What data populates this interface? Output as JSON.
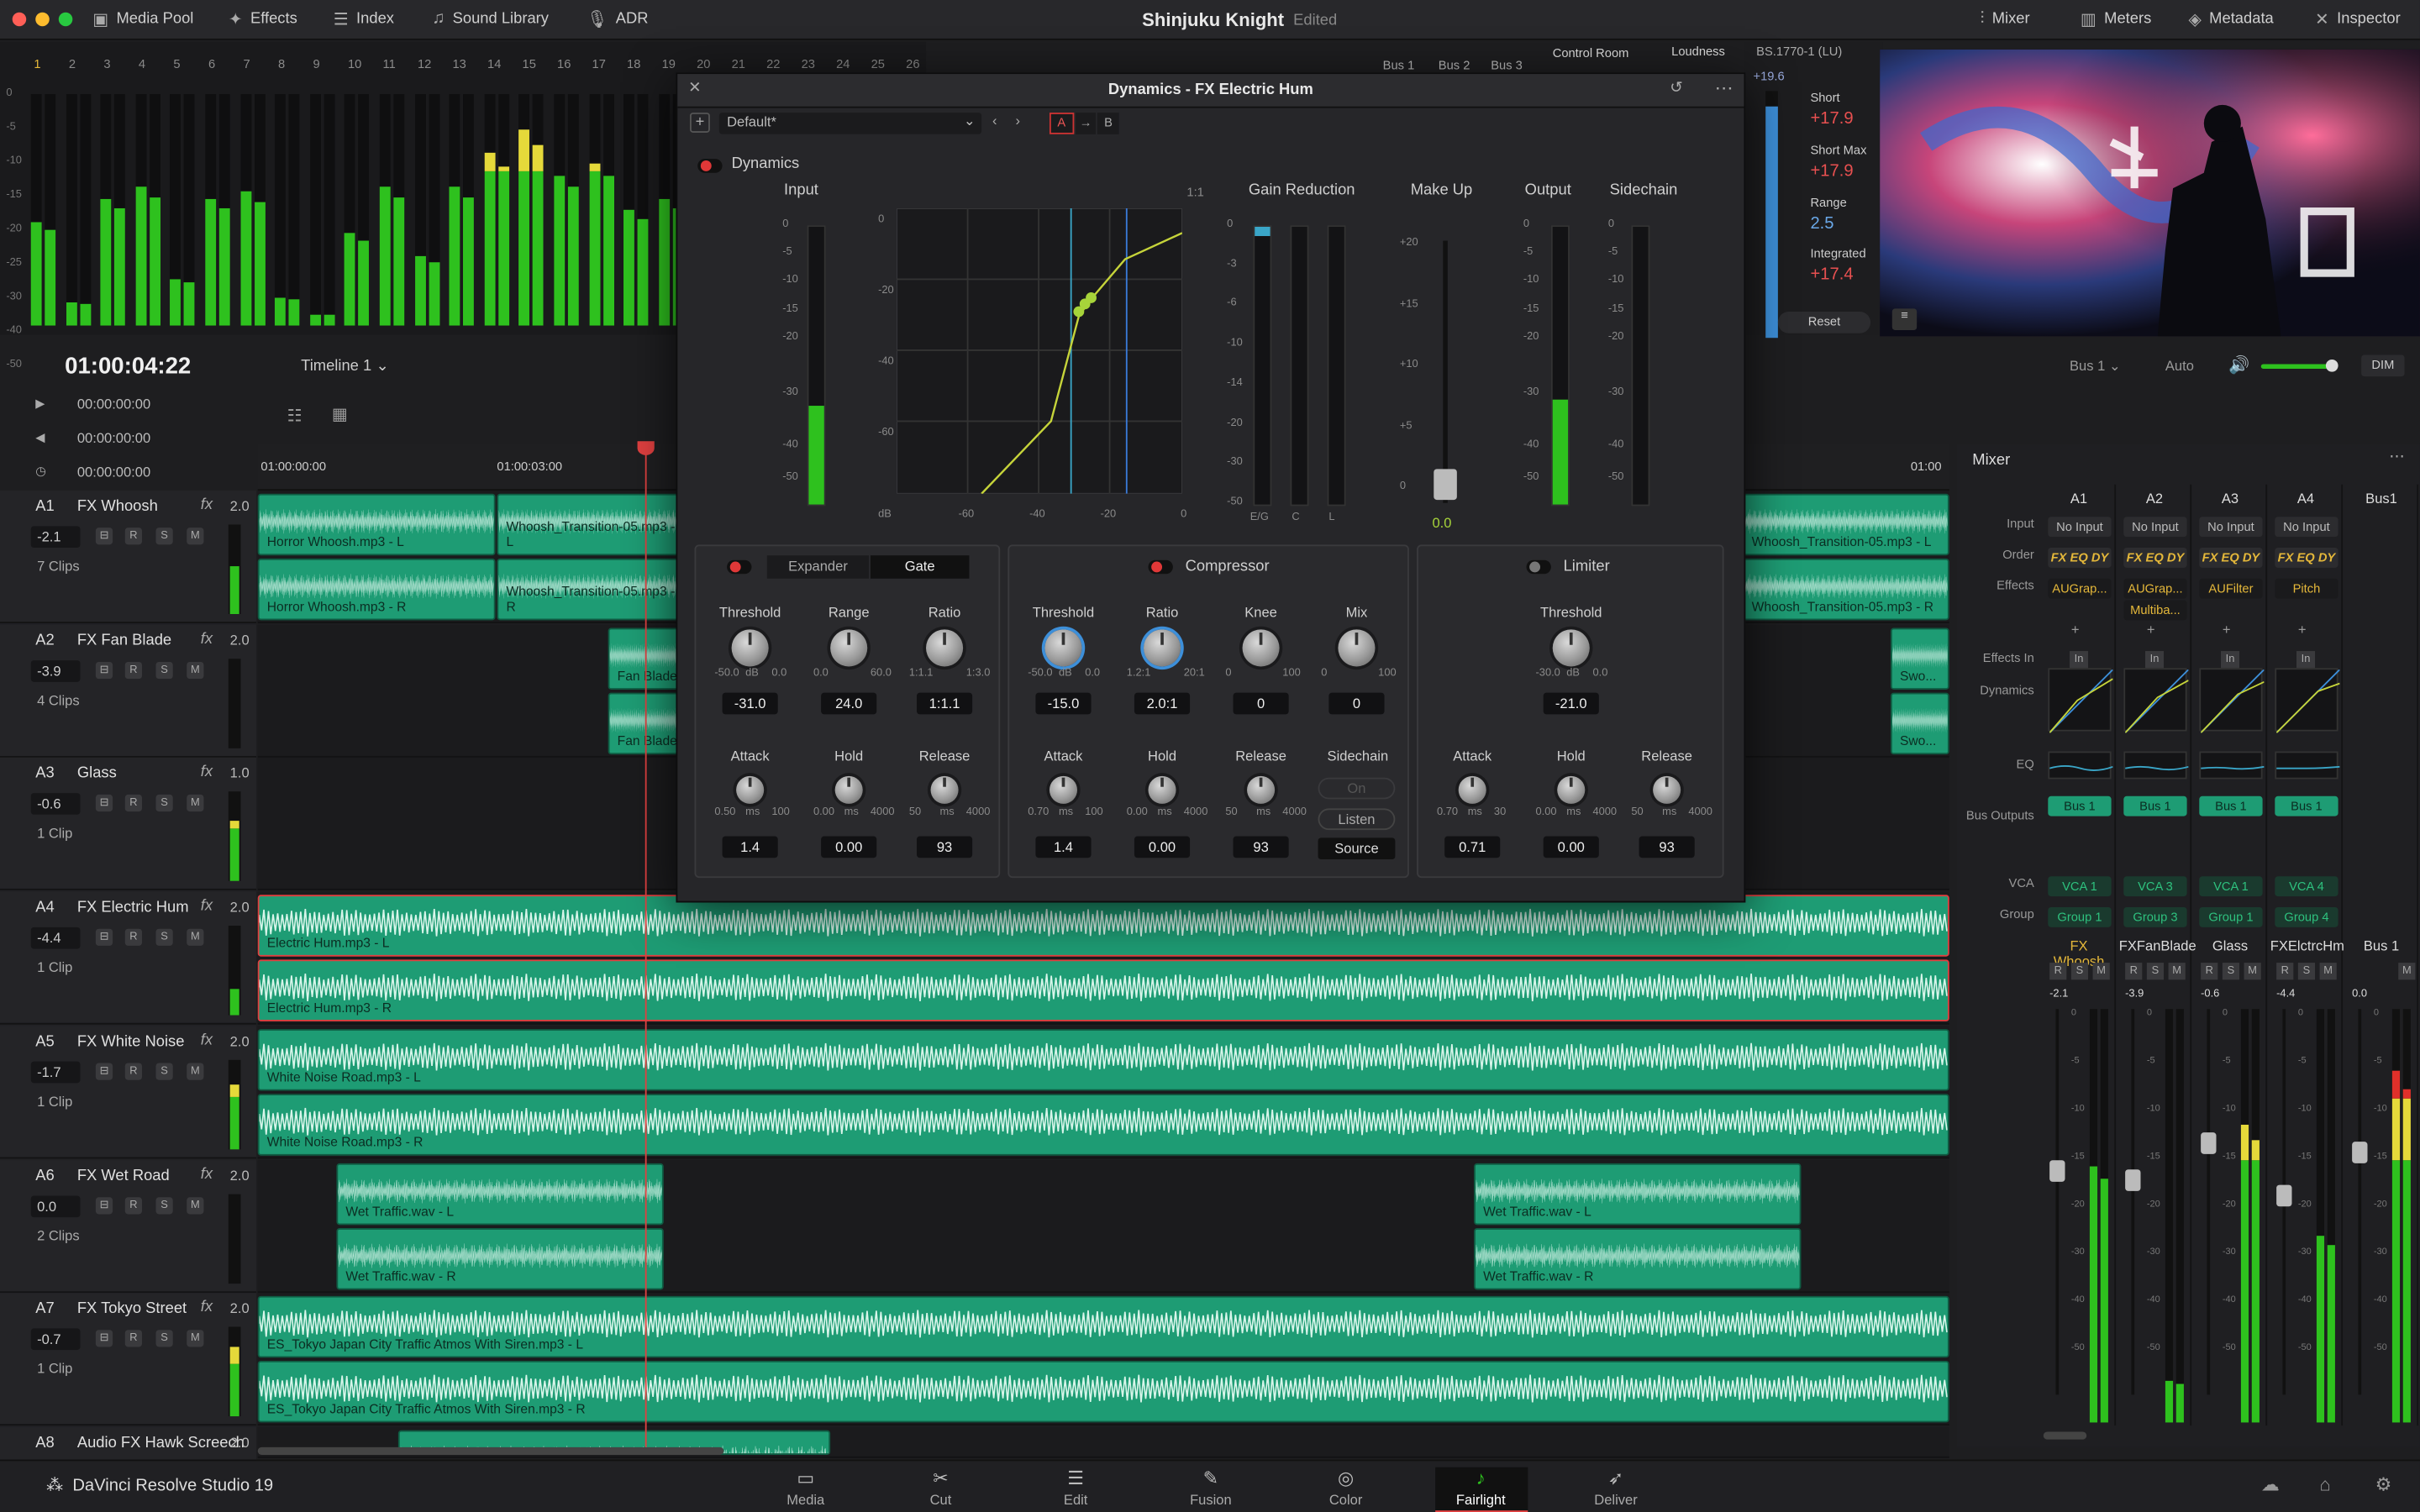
{
  "app": {
    "title": "Shinjuku Knight",
    "status": "Edited",
    "product": "DaVinci Resolve Studio 19"
  },
  "topbar": {
    "left": [
      {
        "icon": "media-pool-icon",
        "label": "Media Pool"
      },
      {
        "icon": "effects-icon",
        "label": "Effects"
      },
      {
        "icon": "index-icon",
        "label": "Index"
      },
      {
        "icon": "sound-library-icon",
        "label": "Sound Library"
      },
      {
        "icon": "adr-icon",
        "label": "ADR"
      }
    ],
    "right": [
      {
        "icon": "mixer-icon",
        "label": "Mixer"
      },
      {
        "icon": "meters-icon",
        "label": "Meters"
      },
      {
        "icon": "metadata-icon",
        "label": "Metadata"
      },
      {
        "icon": "inspector-icon",
        "label": "Inspector"
      }
    ]
  },
  "meters": {
    "channels": [
      "1",
      "2",
      "3",
      "4",
      "5",
      "6",
      "7",
      "8",
      "9",
      "10",
      "11",
      "12",
      "13",
      "14",
      "15",
      "16",
      "17",
      "18",
      "19",
      "20",
      "21",
      "22",
      "23",
      "24",
      "25",
      "26"
    ],
    "db_labels": [
      "0",
      "-5",
      "-10",
      "-15",
      "-20",
      "-25",
      "-30",
      "-40",
      "-50"
    ],
    "levels": [
      0.45,
      0.1,
      0.55,
      0.6,
      0.2,
      0.55,
      0.58,
      0.12,
      0.05,
      0.4,
      0.6,
      0.3,
      0.6,
      0.75,
      0.85,
      0.65,
      0.7,
      0.5,
      0.55,
      0.45,
      0.3,
      0.4,
      0.5,
      0.3,
      0.2,
      0.1
    ]
  },
  "monitor": {
    "tabs": [
      "Bus 1",
      "Bus 2",
      "Bus 3"
    ],
    "control_room": "Control Room",
    "loudness": "Loudness",
    "standard": "BS.1770-1 (LU)",
    "scale_top": "+19.6",
    "short_label": "Short",
    "short_value": "+17.9",
    "shortmax_label": "Short Max",
    "shortmax_value": "+17.9",
    "range_label": "Range",
    "range_value": "2.5",
    "integrated_label": "Integrated",
    "integrated_value": "+17.4",
    "reset": "Reset"
  },
  "timeline": {
    "timecode": "01:00:04:22",
    "name": "Timeline 1",
    "tc_rows": [
      "00:00:00:00",
      "00:00:00:00",
      "00:00:00:00"
    ],
    "ruler": [
      "01:00:00:00",
      "01:00:03:00",
      "01:00"
    ],
    "bus_select": "Bus 1",
    "auto": "Auto",
    "dim": "DIM",
    "tracks": [
      {
        "id": "A1",
        "name": "FX Whoosh",
        "ch": "2.0",
        "vol": "-2.1",
        "clips": "7 Clips",
        "level": 0.55
      },
      {
        "id": "A2",
        "name": "FX Fan Blade",
        "ch": "2.0",
        "vol": "-3.9",
        "clips": "4 Clips",
        "level": 0.0
      },
      {
        "id": "A3",
        "name": "Glass",
        "ch": "1.0",
        "vol": "-0.6",
        "clips": "1 Clip",
        "level": 0.7
      },
      {
        "id": "A4",
        "name": "FX Electric Hum",
        "ch": "2.0",
        "vol": "-4.4",
        "clips": "1 Clip",
        "level": 0.3
      },
      {
        "id": "A5",
        "name": "FX White Noise",
        "ch": "2.0",
        "vol": "-1.7",
        "clips": "1 Clip",
        "level": 0.75
      },
      {
        "id": "A6",
        "name": "FX Wet Road",
        "ch": "2.0",
        "vol": "0.0",
        "clips": "2 Clips",
        "level": 0.0
      },
      {
        "id": "A7",
        "name": "FX Tokyo Street",
        "ch": "2.0",
        "vol": "-0.7",
        "clips": "1 Clip",
        "level": 0.8
      },
      {
        "id": "A8",
        "name": "Audio FX Hawk Screech",
        "ch": "2.0",
        "vol": "",
        "clips": "",
        "level": 0.0
      }
    ],
    "clip_labels": {
      "horror_l": "Horror Whoosh.mp3 - L",
      "horror_r": "Horror Whoosh.mp3 - R",
      "whoosh_l": "Whoosh_Transition-05.mp3 - L",
      "whoosh_r": "Whoosh_Transition-05.mp3 - R",
      "whoosh2_l": "Whoosh_Transition-05.mp3 - L",
      "whoosh2_r": "Whoosh_Transition-05.mp3 - R",
      "fan_l": "Fan Blade",
      "fan_r": "Fan Blade",
      "swo_l": "Swo...",
      "swo_r": "Swo...",
      "hum_l": "Electric Hum.mp3 - L",
      "hum_r": "Electric Hum.mp3 - R",
      "wn_l": "White Noise Road.mp3 - L",
      "wn_r": "White Noise Road.mp3 - R",
      "wet_l": "Wet Traffic.wav - L",
      "wet_r": "Wet Traffic.wav - R",
      "wet2_l": "Wet Traffic.wav - L",
      "wet2_r": "Wet Traffic.wav - R",
      "es_l": "ES_Tokyo Japan City Traffic Atmos With Siren.mp3 - L",
      "es_r": "ES_Tokyo Japan City Traffic Atmos With Siren.mp3 - R"
    }
  },
  "dynamics": {
    "title": "Dynamics - FX Electric Hum",
    "preset": "Default*",
    "ab": [
      "A",
      "→",
      "B"
    ],
    "section_label": "Dynamics",
    "input": "Input",
    "ratio_tag": "1:1",
    "gain_reduction": "Gain Reduction",
    "make_up": "Make Up",
    "output": "Output",
    "sidechain": "Sidechain",
    "makeup_value": "0.0",
    "graph_y": [
      "0",
      "-20",
      "-40",
      "-60"
    ],
    "graph_x": [
      "dB",
      "-60",
      "-40",
      "-20",
      "0"
    ],
    "input_scale": [
      "0",
      "-5",
      "-10",
      "-15",
      "-20",
      "-30",
      "-40",
      "-50"
    ],
    "gr_scale": [
      "0",
      "-3",
      "-6",
      "-10",
      "-14",
      "-20",
      "-30",
      "-50"
    ],
    "gr_foot": [
      "E/G",
      "C",
      "L"
    ],
    "makeup_scale": [
      "+20",
      "+15",
      "+10",
      "+5",
      "0"
    ],
    "expander": {
      "tab_expander": "Expander",
      "tab_gate": "Gate",
      "threshold": {
        "label": "Threshold",
        "min": "-50.0",
        "unit": "dB",
        "max": "0.0",
        "value": "-31.0"
      },
      "range": {
        "label": "Range",
        "min": "0.0",
        "max": "60.0",
        "value": "24.0"
      },
      "ratio": {
        "label": "Ratio",
        "min": "1:1.1",
        "max": "1:3.0",
        "value": "1:1.1"
      },
      "attack": {
        "label": "Attack",
        "min": "0.50",
        "unit": "ms",
        "max": "100",
        "value": "1.4"
      },
      "hold": {
        "label": "Hold",
        "min": "0.00",
        "unit": "ms",
        "max": "4000",
        "value": "0.00"
      },
      "release": {
        "label": "Release",
        "min": "50",
        "unit": "ms",
        "max": "4000",
        "value": "93"
      }
    },
    "compressor": {
      "label": "Compressor",
      "threshold": {
        "label": "Threshold",
        "min": "-50.0",
        "unit": "dB",
        "max": "0.0",
        "value": "-15.0"
      },
      "ratio": {
        "label": "Ratio",
        "min": "1.2:1",
        "max": "20:1",
        "value": "2.0:1"
      },
      "knee": {
        "label": "Knee",
        "min": "0",
        "max": "100",
        "value": "0"
      },
      "mix": {
        "label": "Mix",
        "min": "0",
        "max": "100",
        "value": "0"
      },
      "attack": {
        "label": "Attack",
        "min": "0.70",
        "unit": "ms",
        "max": "100",
        "value": "1.4"
      },
      "hold": {
        "label": "Hold",
        "min": "0.00",
        "unit": "ms",
        "max": "4000",
        "value": "0.00"
      },
      "release": {
        "label": "Release",
        "min": "50",
        "unit": "ms",
        "max": "4000",
        "value": "93"
      },
      "sidechain": "Sidechain",
      "on": "On",
      "listen": "Listen",
      "source": "Source"
    },
    "limiter": {
      "label": "Limiter",
      "threshold": {
        "label": "Threshold",
        "min": "-30.0",
        "unit": "dB",
        "max": "0.0",
        "value": "-21.0"
      },
      "attack": {
        "label": "Attack",
        "min": "0.70",
        "unit": "ms",
        "max": "30",
        "value": "0.71"
      },
      "hold": {
        "label": "Hold",
        "min": "0.00",
        "unit": "ms",
        "max": "4000",
        "value": "0.00"
      },
      "release": {
        "label": "Release",
        "min": "50",
        "unit": "ms",
        "max": "4000",
        "value": "93"
      }
    }
  },
  "mixer": {
    "title": "Mixer",
    "row_labels": [
      "Input",
      "Order",
      "Effects",
      "Effects In",
      "Dynamics",
      "EQ",
      "Bus Outputs",
      "VCA",
      "Group"
    ],
    "channels": [
      {
        "h": "A1",
        "input": "No Input",
        "order": "FX EQ DY",
        "effect": "AUGrap...",
        "effect2": "",
        "bus": "Bus 1",
        "vca": "VCA 1",
        "group": "Group 1",
        "name": "FX Whoosh",
        "vol": "-2.1",
        "level": 0.62
      },
      {
        "h": "A2",
        "input": "No Input",
        "order": "FX EQ DY",
        "effect": "AUGrap...",
        "effect2": "Multiba...",
        "bus": "Bus 1",
        "vca": "VCA 3",
        "group": "Group 3",
        "name": "FXFanBlade",
        "vol": "-3.9",
        "level": 0.1
      },
      {
        "h": "A3",
        "input": "No Input",
        "order": "FX EQ DY",
        "effect": "AUFilter",
        "effect2": "",
        "bus": "Bus 1",
        "vca": "VCA 1",
        "group": "Group 1",
        "name": "Glass",
        "vol": "-0.6",
        "level": 0.72
      },
      {
        "h": "A4",
        "input": "No Input",
        "order": "FX EQ DY",
        "effect": "Pitch",
        "effect2": "",
        "bus": "Bus 1",
        "vca": "VCA 4",
        "group": "Group 4",
        "name": "FXElctrcHm",
        "vol": "-4.4",
        "level": 0.45
      },
      {
        "h": "Bus1",
        "input": "",
        "order": "",
        "effect": "",
        "effect2": "",
        "bus": "",
        "vca": "",
        "group": "",
        "name": "Bus 1",
        "vol": "0.0",
        "level": 0.85
      }
    ],
    "rsm": [
      "R",
      "S",
      "M"
    ],
    "fader_scale": [
      "0",
      "-5",
      "-10",
      "-15",
      "-20",
      "-30",
      "-40",
      "-50"
    ],
    "in_label": "In"
  },
  "pages": [
    {
      "icon": "media-page-icon",
      "label": "Media"
    },
    {
      "icon": "cut-page-icon",
      "label": "Cut"
    },
    {
      "icon": "edit-page-icon",
      "label": "Edit"
    },
    {
      "icon": "fusion-page-icon",
      "label": "Fusion"
    },
    {
      "icon": "color-page-icon",
      "label": "Color"
    },
    {
      "icon": "fairlight-page-icon",
      "label": "Fairlight",
      "active": true
    },
    {
      "icon": "deliver-page-icon",
      "label": "Deliver"
    }
  ],
  "colors": {
    "clip": "#1e9c74",
    "playhead": "#e04040",
    "accent": "#3d8fd9",
    "meter_green": "#2ec11e",
    "meter_yellow": "#e5d93a",
    "meter_red": "#e0302a"
  }
}
